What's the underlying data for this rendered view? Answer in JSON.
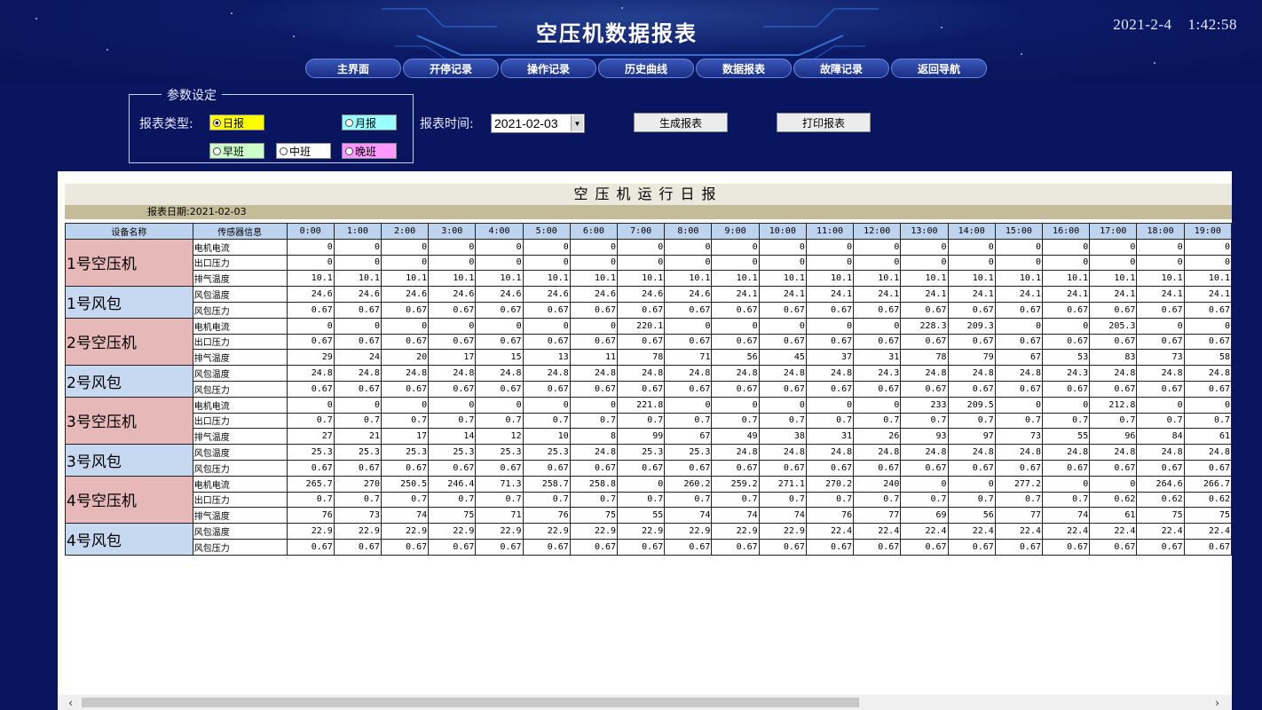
{
  "header": {
    "title": "空压机数据报表",
    "date": "2021-2-4",
    "time": "1:42:58"
  },
  "nav": [
    "主界面",
    "开停记录",
    "操作记录",
    "历史曲线",
    "数据报表",
    "故障记录",
    "返回导航"
  ],
  "params": {
    "legend": "参数设定",
    "report_type_label": "报表类型:",
    "daily": "日报",
    "monthly": "月报",
    "morning": "早班",
    "mid": "中班",
    "night": "晚班",
    "time_label": "报表时间:",
    "date_value": "2021-02-03",
    "generate_button": "生成报表",
    "print_button": "打印报表"
  },
  "report": {
    "title": "空压机运行日报",
    "date_line": "报表日期:2021-02-03",
    "col_device": "设备名称",
    "col_sensor": "传感器信息",
    "hours": [
      "0:00",
      "1:00",
      "2:00",
      "3:00",
      "4:00",
      "5:00",
      "6:00",
      "7:00",
      "8:00",
      "9:00",
      "10:00",
      "11:00",
      "12:00",
      "13:00",
      "14:00",
      "15:00",
      "16:00",
      "17:00",
      "18:00",
      "19:00"
    ],
    "groups": [
      {
        "device": "1号空压机",
        "kind": "compressor",
        "rows": [
          {
            "sensor": "电机电流",
            "values": [
              "0",
              "0",
              "0",
              "0",
              "0",
              "0",
              "0",
              "0",
              "0",
              "0",
              "0",
              "0",
              "0",
              "0",
              "0",
              "0",
              "0",
              "0",
              "0",
              "0"
            ]
          },
          {
            "sensor": "出口压力",
            "values": [
              "0",
              "0",
              "0",
              "0",
              "0",
              "0",
              "0",
              "0",
              "0",
              "0",
              "0",
              "0",
              "0",
              "0",
              "0",
              "0",
              "0",
              "0",
              "0",
              "0"
            ]
          },
          {
            "sensor": "排气温度",
            "values": [
              "10.1",
              "10.1",
              "10.1",
              "10.1",
              "10.1",
              "10.1",
              "10.1",
              "10.1",
              "10.1",
              "10.1",
              "10.1",
              "10.1",
              "10.1",
              "10.1",
              "10.1",
              "10.1",
              "10.1",
              "10.1",
              "10.1",
              "10.1"
            ]
          }
        ]
      },
      {
        "device": "1号风包",
        "kind": "tank",
        "rows": [
          {
            "sensor": "风包温度",
            "values": [
              "24.6",
              "24.6",
              "24.6",
              "24.6",
              "24.6",
              "24.6",
              "24.6",
              "24.6",
              "24.6",
              "24.1",
              "24.1",
              "24.1",
              "24.1",
              "24.1",
              "24.1",
              "24.1",
              "24.1",
              "24.1",
              "24.1",
              "24.1"
            ]
          },
          {
            "sensor": "风包压力",
            "values": [
              "0.67",
              "0.67",
              "0.67",
              "0.67",
              "0.67",
              "0.67",
              "0.67",
              "0.67",
              "0.67",
              "0.67",
              "0.67",
              "0.67",
              "0.67",
              "0.67",
              "0.67",
              "0.67",
              "0.67",
              "0.67",
              "0.67",
              "0.67"
            ]
          }
        ]
      },
      {
        "device": "2号空压机",
        "kind": "compressor",
        "rows": [
          {
            "sensor": "电机电流",
            "values": [
              "0",
              "0",
              "0",
              "0",
              "0",
              "0",
              "0",
              "220.1",
              "0",
              "0",
              "0",
              "0",
              "0",
              "228.3",
              "209.3",
              "0",
              "0",
              "205.3",
              "0",
              "0"
            ]
          },
          {
            "sensor": "出口压力",
            "values": [
              "0.67",
              "0.67",
              "0.67",
              "0.67",
              "0.67",
              "0.67",
              "0.67",
              "0.67",
              "0.67",
              "0.67",
              "0.67",
              "0.67",
              "0.67",
              "0.67",
              "0.67",
              "0.67",
              "0.67",
              "0.67",
              "0.67",
              "0.67"
            ]
          },
          {
            "sensor": "排气温度",
            "values": [
              "29",
              "24",
              "20",
              "17",
              "15",
              "13",
              "11",
              "78",
              "71",
              "56",
              "45",
              "37",
              "31",
              "78",
              "79",
              "67",
              "53",
              "83",
              "73",
              "58"
            ]
          }
        ]
      },
      {
        "device": "2号风包",
        "kind": "tank",
        "rows": [
          {
            "sensor": "风包温度",
            "values": [
              "24.8",
              "24.8",
              "24.8",
              "24.8",
              "24.8",
              "24.8",
              "24.8",
              "24.8",
              "24.8",
              "24.8",
              "24.8",
              "24.8",
              "24.3",
              "24.8",
              "24.8",
              "24.8",
              "24.3",
              "24.8",
              "24.8",
              "24.8"
            ]
          },
          {
            "sensor": "风包压力",
            "values": [
              "0.67",
              "0.67",
              "0.67",
              "0.67",
              "0.67",
              "0.67",
              "0.67",
              "0.67",
              "0.67",
              "0.67",
              "0.67",
              "0.67",
              "0.67",
              "0.67",
              "0.67",
              "0.67",
              "0.67",
              "0.67",
              "0.67",
              "0.67"
            ]
          }
        ]
      },
      {
        "device": "3号空压机",
        "kind": "compressor",
        "rows": [
          {
            "sensor": "电机电流",
            "values": [
              "0",
              "0",
              "0",
              "0",
              "0",
              "0",
              "0",
              "221.8",
              "0",
              "0",
              "0",
              "0",
              "0",
              "233",
              "209.5",
              "0",
              "0",
              "212.8",
              "0",
              "0"
            ]
          },
          {
            "sensor": "出口压力",
            "values": [
              "0.7",
              "0.7",
              "0.7",
              "0.7",
              "0.7",
              "0.7",
              "0.7",
              "0.7",
              "0.7",
              "0.7",
              "0.7",
              "0.7",
              "0.7",
              "0.7",
              "0.7",
              "0.7",
              "0.7",
              "0.7",
              "0.7",
              "0.7"
            ]
          },
          {
            "sensor": "排气温度",
            "values": [
              "27",
              "21",
              "17",
              "14",
              "12",
              "10",
              "8",
              "99",
              "67",
              "49",
              "38",
              "31",
              "26",
              "93",
              "97",
              "73",
              "55",
              "96",
              "84",
              "61"
            ]
          }
        ]
      },
      {
        "device": "3号风包",
        "kind": "tank",
        "rows": [
          {
            "sensor": "风包温度",
            "values": [
              "25.3",
              "25.3",
              "25.3",
              "25.3",
              "25.3",
              "25.3",
              "24.8",
              "25.3",
              "25.3",
              "24.8",
              "24.8",
              "24.8",
              "24.8",
              "24.8",
              "24.8",
              "24.8",
              "24.8",
              "24.8",
              "24.8",
              "24.8"
            ]
          },
          {
            "sensor": "风包压力",
            "values": [
              "0.67",
              "0.67",
              "0.67",
              "0.67",
              "0.67",
              "0.67",
              "0.67",
              "0.67",
              "0.67",
              "0.67",
              "0.67",
              "0.67",
              "0.67",
              "0.67",
              "0.67",
              "0.67",
              "0.67",
              "0.67",
              "0.67",
              "0.67"
            ]
          }
        ]
      },
      {
        "device": "4号空压机",
        "kind": "compressor",
        "rows": [
          {
            "sensor": "电机电流",
            "values": [
              "265.7",
              "270",
              "250.5",
              "246.4",
              "71.3",
              "258.7",
              "258.8",
              "0",
              "260.2",
              "259.2",
              "271.1",
              "270.2",
              "240",
              "0",
              "0",
              "277.2",
              "0",
              "0",
              "264.6",
              "266.7"
            ]
          },
          {
            "sensor": "出口压力",
            "values": [
              "0.7",
              "0.7",
              "0.7",
              "0.7",
              "0.7",
              "0.7",
              "0.7",
              "0.7",
              "0.7",
              "0.7",
              "0.7",
              "0.7",
              "0.7",
              "0.7",
              "0.7",
              "0.7",
              "0.7",
              "0.62",
              "0.62",
              "0.62"
            ]
          },
          {
            "sensor": "排气温度",
            "values": [
              "76",
              "73",
              "74",
              "75",
              "71",
              "76",
              "75",
              "55",
              "74",
              "74",
              "74",
              "76",
              "77",
              "69",
              "56",
              "77",
              "74",
              "61",
              "75",
              "75"
            ]
          }
        ]
      },
      {
        "device": "4号风包",
        "kind": "tank",
        "rows": [
          {
            "sensor": "风包温度",
            "values": [
              "22.9",
              "22.9",
              "22.9",
              "22.9",
              "22.9",
              "22.9",
              "22.9",
              "22.9",
              "22.9",
              "22.9",
              "22.9",
              "22.4",
              "22.4",
              "22.4",
              "22.4",
              "22.4",
              "22.4",
              "22.4",
              "22.4",
              "22.4"
            ]
          },
          {
            "sensor": "风包压力",
            "values": [
              "0.67",
              "0.67",
              "0.67",
              "0.67",
              "0.67",
              "0.67",
              "0.67",
              "0.67",
              "0.67",
              "0.67",
              "0.67",
              "0.67",
              "0.67",
              "0.67",
              "0.67",
              "0.67",
              "0.67",
              "0.67",
              "0.67",
              "0.67"
            ]
          }
        ]
      }
    ]
  },
  "scrollbar": {
    "left_arrow": "‹",
    "right_arrow": "›"
  },
  "colors": {
    "background": "#0a1560",
    "compressor_cell": "#e6b8b7",
    "tank_cell": "#c6d9f0",
    "header_cell": "#bed3ee",
    "daily": "#ffff00",
    "monthly": "#99ffff",
    "morning": "#ccffcc",
    "night": "#ff99ff"
  }
}
